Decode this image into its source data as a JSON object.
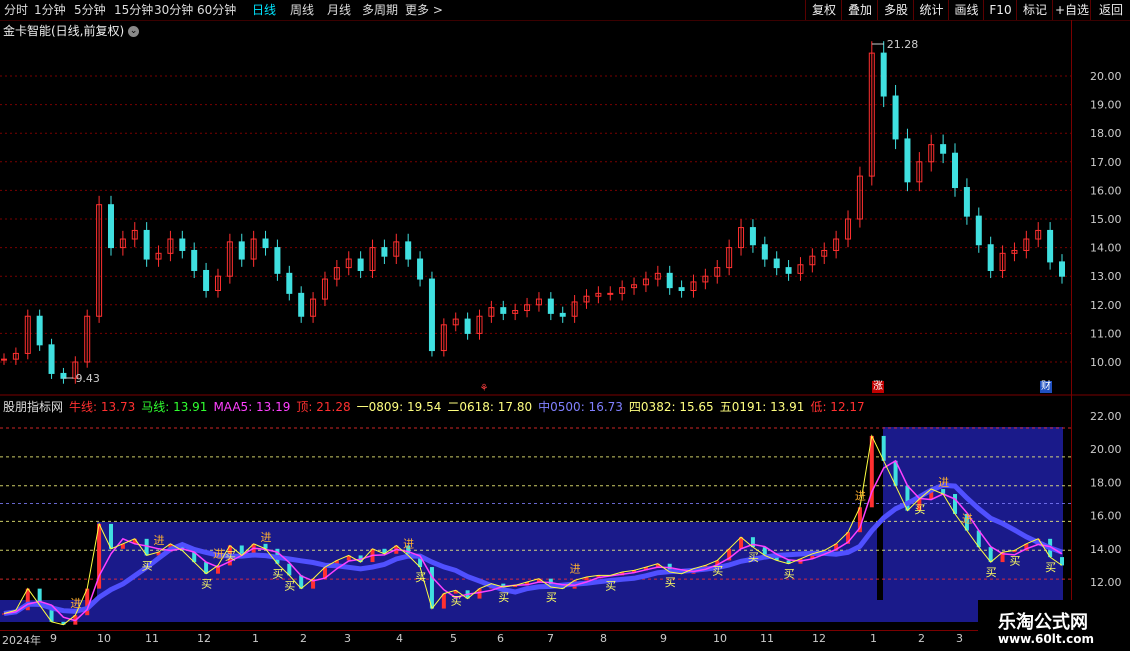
{
  "toolbar": {
    "periods": [
      {
        "label": "分时",
        "active": false
      },
      {
        "label": "1分钟",
        "active": false
      },
      {
        "label": "5分钟",
        "active": false
      },
      {
        "label": "15分钟",
        "active": false
      },
      {
        "label": "30分钟",
        "active": false
      },
      {
        "label": "60分钟",
        "active": false
      },
      {
        "label": "日线",
        "active": true
      },
      {
        "label": "周线",
        "active": false
      },
      {
        "label": "月线",
        "active": false
      },
      {
        "label": "多周期",
        "active": false
      },
      {
        "label": "更多 >",
        "active": false
      }
    ],
    "right_buttons": [
      "复权",
      "叠加",
      "多股",
      "统计",
      "画线",
      "F10",
      "标记",
      "+自选",
      "返回"
    ]
  },
  "main_chart": {
    "title": "金卡智能(日线,前复权)",
    "high_label": "21.28",
    "low_label": "9.43",
    "y_ticks": [
      "20.00",
      "19.00",
      "18.00",
      "17.00",
      "16.00",
      "15.00",
      "14.00",
      "13.00",
      "12.00",
      "11.00",
      "10.00"
    ],
    "markers": {
      "zhang": "涨",
      "cai": "财",
      "other": "⚘"
    }
  },
  "sub_chart": {
    "legend": [
      {
        "text": "股朋指标网",
        "color": "#dddddd"
      },
      {
        "text": "牛线: 13.73",
        "color": "#ff3030"
      },
      {
        "text": "马线: 13.91",
        "color": "#30ff30"
      },
      {
        "text": "MAA5: 13.19",
        "color": "#ff40ff"
      },
      {
        "text": "顶: 21.28",
        "color": "#ff3030"
      },
      {
        "text": "一0809: 19.54",
        "color": "#ffff80"
      },
      {
        "text": "二0618: 17.80",
        "color": "#ffff80"
      },
      {
        "text": "中0500: 16.73",
        "color": "#8080ff"
      },
      {
        "text": "四0382: 15.65",
        "color": "#ffff80"
      },
      {
        "text": "五0191: 13.91",
        "color": "#ffff80"
      },
      {
        "text": "低: 12.17",
        "color": "#ff3030"
      }
    ],
    "y_ticks": [
      "22.00",
      "20.00",
      "18.00",
      "16.00",
      "14.00",
      "12.00"
    ],
    "signal_in": "进",
    "signal_buy": "买"
  },
  "x_axis": {
    "labels": [
      "2024年",
      "9",
      "10",
      "11",
      "12",
      "1",
      "2",
      "3",
      "4",
      "5",
      "6",
      "7",
      "8",
      "9",
      "10",
      "11",
      "12",
      "1",
      "2",
      "3"
    ]
  },
  "watermark": {
    "line1": "乐淘公式网",
    "line2": "www.60lt.com"
  },
  "chart_data": {
    "type": "candlestick",
    "series": [
      {
        "name": "close",
        "values": [
          10.1,
          10.3,
          11.6,
          10.6,
          9.6,
          9.43,
          10.0,
          11.6,
          15.5,
          14.0,
          14.3,
          14.6,
          13.6,
          13.8,
          14.3,
          13.9,
          13.2,
          12.5,
          13.0,
          14.2,
          13.6,
          14.3,
          14.0,
          13.1,
          12.4,
          11.6,
          12.2,
          12.9,
          13.3,
          13.6,
          13.2,
          14.0,
          13.7,
          14.2,
          13.6,
          12.9,
          10.4,
          11.3,
          11.5,
          11.0,
          11.6,
          11.9,
          11.7,
          11.8,
          12.0,
          12.2,
          11.7,
          11.6,
          12.1,
          12.3,
          12.4,
          12.4,
          12.6,
          12.7,
          12.9,
          13.1,
          12.6,
          12.5,
          12.8,
          13.0,
          13.3,
          14.0,
          14.7,
          14.1,
          13.6,
          13.3,
          13.1,
          13.4,
          13.7,
          13.9,
          14.3,
          15.0,
          16.5,
          20.8,
          19.3,
          17.8,
          16.3,
          17.0,
          17.6,
          17.3,
          16.1,
          15.1,
          14.1,
          13.2,
          13.8,
          13.9,
          14.3,
          14.6,
          13.5,
          13.0
        ]
      }
    ],
    "sub_lines": {
      "ding": 21.28,
      "yi": 19.54,
      "er": 17.8,
      "zhong": 16.73,
      "si": 15.65,
      "wu": 13.91,
      "di": 12.17
    }
  }
}
